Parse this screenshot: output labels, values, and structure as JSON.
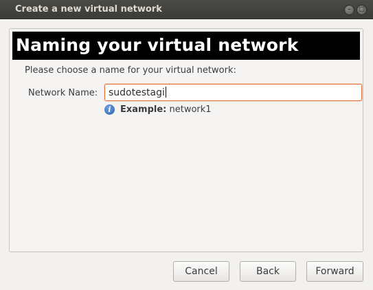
{
  "window": {
    "title": "Create a new virtual network",
    "minimize_glyph": "–",
    "maximize_glyph": "□"
  },
  "page": {
    "heading": "Naming your virtual network",
    "prompt": "Please choose a name for your virtual network:"
  },
  "form": {
    "network_name_label": "Network Name:",
    "network_name_value": "sudotestagi",
    "info_icon_glyph": "i",
    "example_key": "Example:",
    "example_value": " network1"
  },
  "buttons": {
    "cancel": "Cancel",
    "back": "Back",
    "forward": "Forward"
  },
  "colors": {
    "titlebar": "#3b3b37",
    "banner": "#000000",
    "input_focus_border": "#e0733c",
    "info_icon": "#2d63ad"
  },
  "icons": [
    "minimize-icon",
    "maximize-icon",
    "info-icon"
  ]
}
